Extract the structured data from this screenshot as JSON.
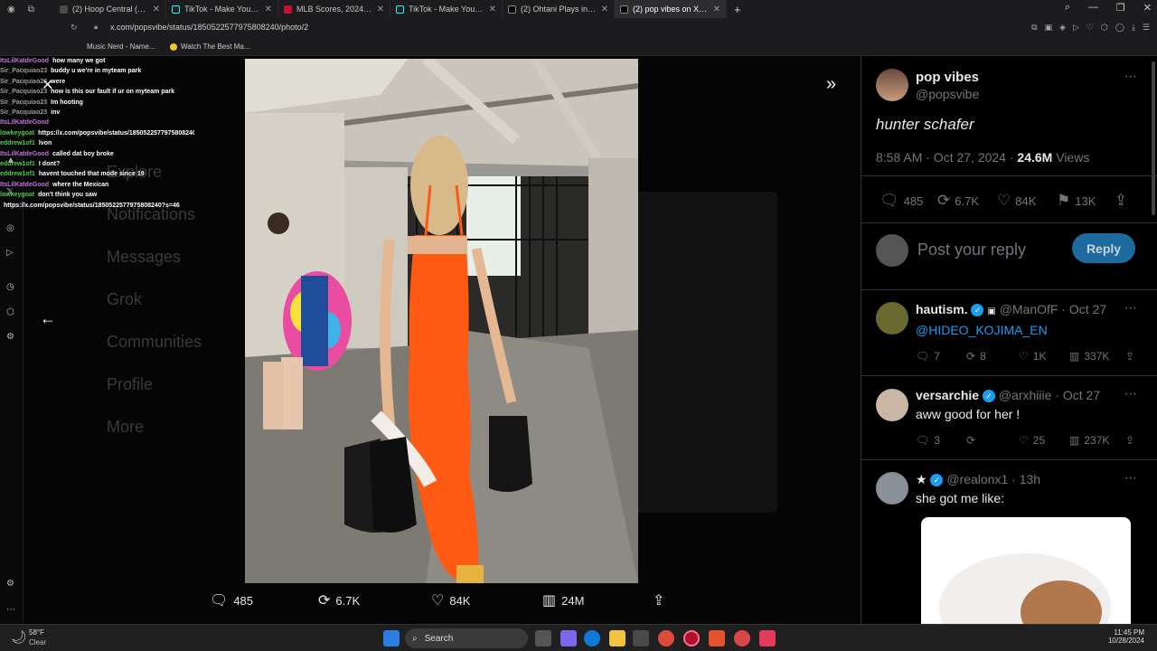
{
  "tabs": [
    {
      "label": "(2) Hoop Central (@TheHo",
      "color": "#4a4a4a"
    },
    {
      "label": "TikTok - Make Your Day",
      "color": "#111"
    },
    {
      "label": "MLB Scores, 2024 Season -",
      "color": "#c8102e"
    },
    {
      "label": "TikTok - Make Your Day",
      "color": "#111"
    },
    {
      "label": "(2) Ohtani Plays in World S",
      "color": "#111"
    },
    {
      "label": "(2) pop vibes on X: \"hunter",
      "color": "#111"
    }
  ],
  "address": {
    "url": "x.com/popsvibe/status/1850522577975808240/photo/2"
  },
  "bookmarks": [
    {
      "label": "Music Nerd - Name..."
    },
    {
      "label": "Watch The Best Ma..."
    }
  ],
  "chat": [
    {
      "user": "ItsLilKatdeGood",
      "msg": "how many we got",
      "color": "#c070e0"
    },
    {
      "user": "Sir_Pacquiao23",
      "msg": "buddy u we're in myteam park",
      "color": "#9a9a9a"
    },
    {
      "user": "Sir_Pacquiao23",
      "msg": "were",
      "color": "#9a9a9a"
    },
    {
      "user": "Sir_Pacquiao23",
      "msg": "how is this our fault if ur on myteam park",
      "color": "#9a9a9a"
    },
    {
      "user": "Sir_Pacquiao23",
      "msg": "Im hooting",
      "color": "#9a9a9a"
    },
    {
      "user": "Sir_Pacquiao23",
      "msg": "inv",
      "color": "#9a9a9a"
    },
    {
      "user": "ItsLilKatdeGood",
      "msg": "",
      "color": "#c070e0"
    },
    {
      "user": "lowkeygoat",
      "msg": "https://x.com/popsvibe/status/1850522577975808240?s=46",
      "color": "#4fc94f"
    },
    {
      "user": "eddrew1of1",
      "msg": "lvon",
      "color": "#4fc94f"
    },
    {
      "user": "ItsLilKatdeGood",
      "msg": "called dat boy broke",
      "color": "#c070e0"
    },
    {
      "user": "eddrew1of1",
      "msg": "I dont?",
      "color": "#4fc94f"
    },
    {
      "user": "eddrew1of1",
      "msg": "havent touched that mode since 19",
      "color": "#4fc94f"
    },
    {
      "user": "ItsLilKatdeGood",
      "msg": "where the Mexican",
      "color": "#c070e0"
    },
    {
      "user": "lowkeygoat",
      "msg": "don't think you saw",
      "color": "#4fc94f"
    },
    {
      "user": "",
      "msg": "https://x.com/popsvibe/status/1850522577975808240?s=46",
      "color": "#4fc94f"
    }
  ],
  "background_nav": [
    "Explore",
    "Notifications",
    "Messages",
    "Grok",
    "Communities",
    "Profile",
    "More"
  ],
  "actions": {
    "replies": "485",
    "reposts": "6.7K",
    "likes": "84K",
    "views": "24M"
  },
  "panel": {
    "author": "pop vibes",
    "handle": "@popsvibe",
    "text": "hunter schafer",
    "time": "8:58 AM · Oct 27, 2024 ·",
    "views": "24.6M",
    "views_label": "Views",
    "counts": {
      "replies": "485",
      "reposts": "6.7K",
      "likes": "84K",
      "bookmarks": "13K"
    },
    "reply_placeholder": "Post your reply",
    "reply_button": "Reply",
    "replies": [
      {
        "name": "hautism.",
        "handle": "@ManOfF · Oct 27",
        "text": "@HIDEO_KOJIMA_EN",
        "replies": "7",
        "reposts": "8",
        "likes": "1K",
        "views": "337K"
      },
      {
        "name": "versarchie",
        "handle": "@arxhiiie · Oct 27",
        "text": "aww good for her !",
        "replies": "3",
        "reposts": "",
        "likes": "25",
        "views": "237K"
      },
      {
        "name": "★",
        "handle": "@realonx1 · 13h",
        "text": "she got me like:"
      }
    ]
  },
  "taskbar": {
    "temp": "58°F",
    "weather": "Clear",
    "search": "Search",
    "time": "11:45 PM",
    "date": "10/28/2024"
  },
  "colors": {
    "accent": "#1d9bf0",
    "dress": "#ff5a14"
  }
}
